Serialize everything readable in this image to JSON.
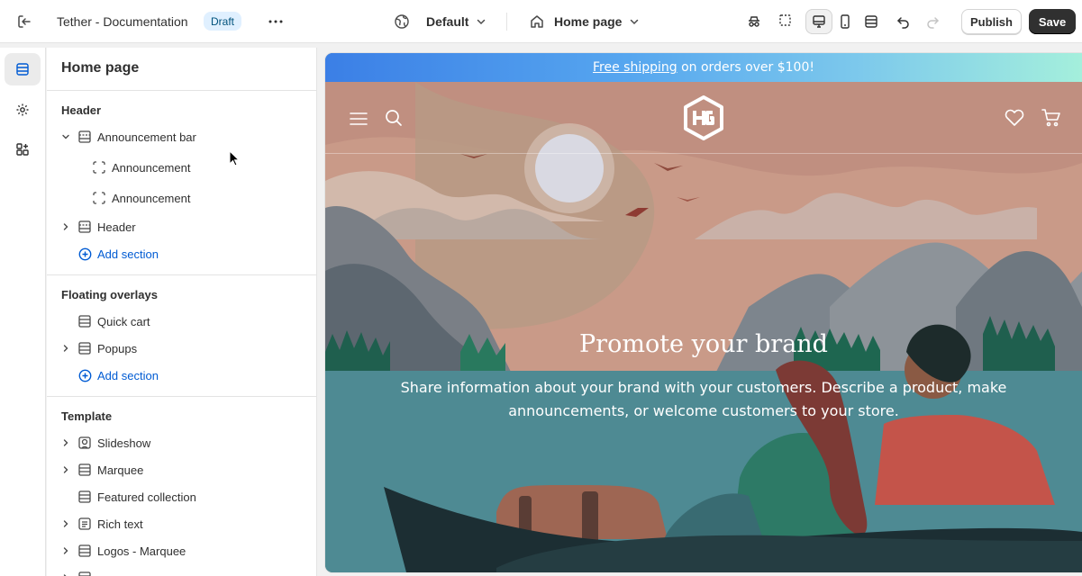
{
  "topbar": {
    "title": "Tether - Documentation",
    "badge": "Draft",
    "theme_label": "Default",
    "page_label": "Home page",
    "publish_label": "Publish",
    "save_label": "Save"
  },
  "sidebar": {
    "title": "Home page",
    "header_group": {
      "title": "Header",
      "items": [
        {
          "label": "Announcement bar",
          "expanded": true
        },
        {
          "label": "Announcement"
        },
        {
          "label": "Announcement"
        },
        {
          "label": "Header",
          "expanded": false
        }
      ],
      "add_label": "Add section"
    },
    "overlay_group": {
      "title": "Floating overlays",
      "items": [
        {
          "label": "Quick cart"
        },
        {
          "label": "Popups",
          "expanded": false
        }
      ],
      "add_label": "Add section"
    },
    "template_group": {
      "title": "Template",
      "items": [
        {
          "label": "Slideshow"
        },
        {
          "label": "Marquee"
        },
        {
          "label": "Featured collection"
        },
        {
          "label": "Rich text"
        },
        {
          "label": "Logos - Marquee"
        }
      ]
    }
  },
  "preview": {
    "promo_link": "Free shipping",
    "promo_rest": " on orders over $100!",
    "hero_title": "Promote your brand",
    "hero_text": "Share information about your brand with your customers. Describe a product, make announcements, or welcome customers to your store."
  },
  "colors": {
    "accent_link": "#005bd3",
    "save_bg": "#303030",
    "badge_bg": "#e0f0ff"
  }
}
